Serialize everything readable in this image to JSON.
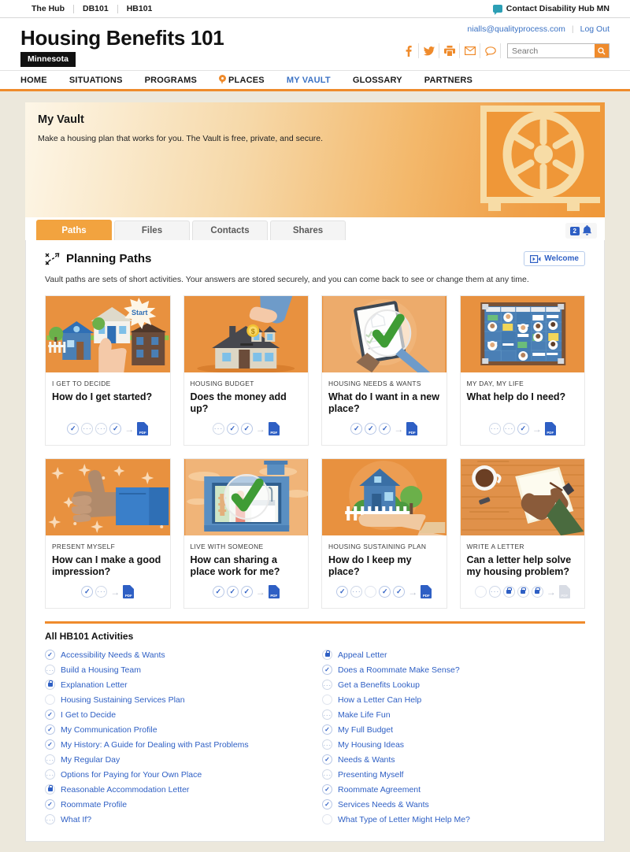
{
  "topbar": {
    "links": [
      "The Hub",
      "DB101",
      "HB101"
    ],
    "contact": "Contact Disability Hub MN",
    "contact_icon": "chat-bubble-icon"
  },
  "header": {
    "site_title": "Housing Benefits 101",
    "state_badge": "Minnesota",
    "user_email": "nialls@qualityprocess.com",
    "logout": "Log Out",
    "social_icons": [
      "facebook-icon",
      "twitter-icon",
      "print-icon",
      "email-icon",
      "chat-icon"
    ],
    "search": {
      "value": "",
      "placeholder": "Search",
      "button_icon": "search-icon"
    }
  },
  "nav": {
    "items": [
      {
        "label": "HOME",
        "active": false,
        "icon": null
      },
      {
        "label": "SITUATIONS",
        "active": false,
        "icon": null
      },
      {
        "label": "PROGRAMS",
        "active": false,
        "icon": null
      },
      {
        "label": "PLACES",
        "active": false,
        "icon": "map-pin-icon"
      },
      {
        "label": "MY VAULT",
        "active": true,
        "icon": null
      },
      {
        "label": "GLOSSARY",
        "active": false,
        "icon": null
      },
      {
        "label": "PARTNERS",
        "active": false,
        "icon": null
      }
    ]
  },
  "banner": {
    "title": "My Vault",
    "subtitle": "Make a housing plan that works for you. The Vault is free, private, and secure.",
    "art": "safe-vault-illustration"
  },
  "tabs": {
    "items": [
      {
        "label": "Paths",
        "active": true
      },
      {
        "label": "Files",
        "active": false
      },
      {
        "label": "Contacts",
        "active": false
      },
      {
        "label": "Shares",
        "active": false
      }
    ],
    "notifications": {
      "count": "2",
      "icon": "bell-icon"
    }
  },
  "panel": {
    "icon": "planning-paths-icon",
    "title": "Planning Paths",
    "welcome_button": {
      "label": "Welcome",
      "icon": "video-play-icon"
    },
    "description": "Vault paths are sets of short activities. Your answers are stored securely, and you can come back to see or change them at any time."
  },
  "cards": [
    {
      "kicker": "I GET TO DECIDE",
      "title": "How do I get started?",
      "art": "houses-with-pointing-hand-and-start-burst",
      "steps": [
        "done",
        "partial",
        "partial",
        "done"
      ],
      "pdf_enabled": true
    },
    {
      "kicker": "HOUSING BUDGET",
      "title": "Does the money add up?",
      "art": "house-with-hand-dropping-coin",
      "steps": [
        "partial",
        "done",
        "done"
      ],
      "pdf_enabled": true
    },
    {
      "kicker": "HOUSING NEEDS & WANTS",
      "title": "What do I want in a new place?",
      "art": "magnifying-glass-over-checklist",
      "steps": [
        "done",
        "done",
        "done"
      ],
      "pdf_enabled": true
    },
    {
      "kicker": "MY DAY, MY LIFE",
      "title": "What help do I need?",
      "art": "planning-board-with-cards",
      "steps": [
        "partial",
        "partial",
        "done"
      ],
      "pdf_enabled": true
    },
    {
      "kicker": "PRESENT MYSELF",
      "title": "How can I make a good impression?",
      "art": "thumbs-up-with-stars",
      "steps": [
        "done",
        "partial"
      ],
      "pdf_enabled": true
    },
    {
      "kicker": "LIVE WITH SOMEONE",
      "title": "How can sharing a place work for me?",
      "art": "apartment-window-with-checkmark",
      "steps": [
        "done",
        "done",
        "done"
      ],
      "pdf_enabled": true
    },
    {
      "kicker": "HOUSING SUSTAINING PLAN",
      "title": "How do I keep my place?",
      "art": "hand-holding-blue-house",
      "steps": [
        "done",
        "partial",
        "empty",
        "done",
        "done"
      ],
      "pdf_enabled": true
    },
    {
      "kicker": "WRITE A LETTER",
      "title": "Can a letter help solve my housing problem?",
      "art": "hand-writing-letter-with-coffee",
      "steps": [
        "empty",
        "partial",
        "locked",
        "locked",
        "locked"
      ],
      "pdf_enabled": false
    }
  ],
  "activities": {
    "heading": "All HB101 Activities",
    "left": [
      {
        "label": "Accessibility Needs & Wants",
        "state": "done"
      },
      {
        "label": "Build a Housing Team",
        "state": "partial"
      },
      {
        "label": "Explanation Letter",
        "state": "locked"
      },
      {
        "label": "Housing Sustaining Services Plan",
        "state": "empty"
      },
      {
        "label": "I Get to Decide",
        "state": "done"
      },
      {
        "label": "My Communication Profile",
        "state": "done"
      },
      {
        "label": "My History: A Guide for Dealing with Past Problems",
        "state": "done"
      },
      {
        "label": "My Regular Day",
        "state": "partial"
      },
      {
        "label": "Options for Paying for Your Own Place",
        "state": "partial"
      },
      {
        "label": "Reasonable Accommodation Letter",
        "state": "locked"
      },
      {
        "label": "Roommate Profile",
        "state": "done"
      },
      {
        "label": "What If?",
        "state": "partial"
      }
    ],
    "right": [
      {
        "label": "Appeal Letter",
        "state": "locked"
      },
      {
        "label": "Does a Roommate Make Sense?",
        "state": "done"
      },
      {
        "label": "Get a Benefits Lookup",
        "state": "partial"
      },
      {
        "label": "How a Letter Can Help",
        "state": "empty"
      },
      {
        "label": "Make Life Fun",
        "state": "partial"
      },
      {
        "label": "My Full Budget",
        "state": "done"
      },
      {
        "label": "My Housing Ideas",
        "state": "partial"
      },
      {
        "label": "Needs & Wants",
        "state": "done"
      },
      {
        "label": "Presenting Myself",
        "state": "partial"
      },
      {
        "label": "Roommate Agreement",
        "state": "done"
      },
      {
        "label": "Services Needs & Wants",
        "state": "done"
      },
      {
        "label": "What Type of Letter Might Help Me?",
        "state": "empty"
      }
    ]
  },
  "colors": {
    "accent_orange": "#ef8b2c",
    "tab_orange": "#f2a33f",
    "link_blue": "#2e5fc4",
    "nav_active_blue": "#3b72c4",
    "page_bg": "#ece8dc"
  }
}
